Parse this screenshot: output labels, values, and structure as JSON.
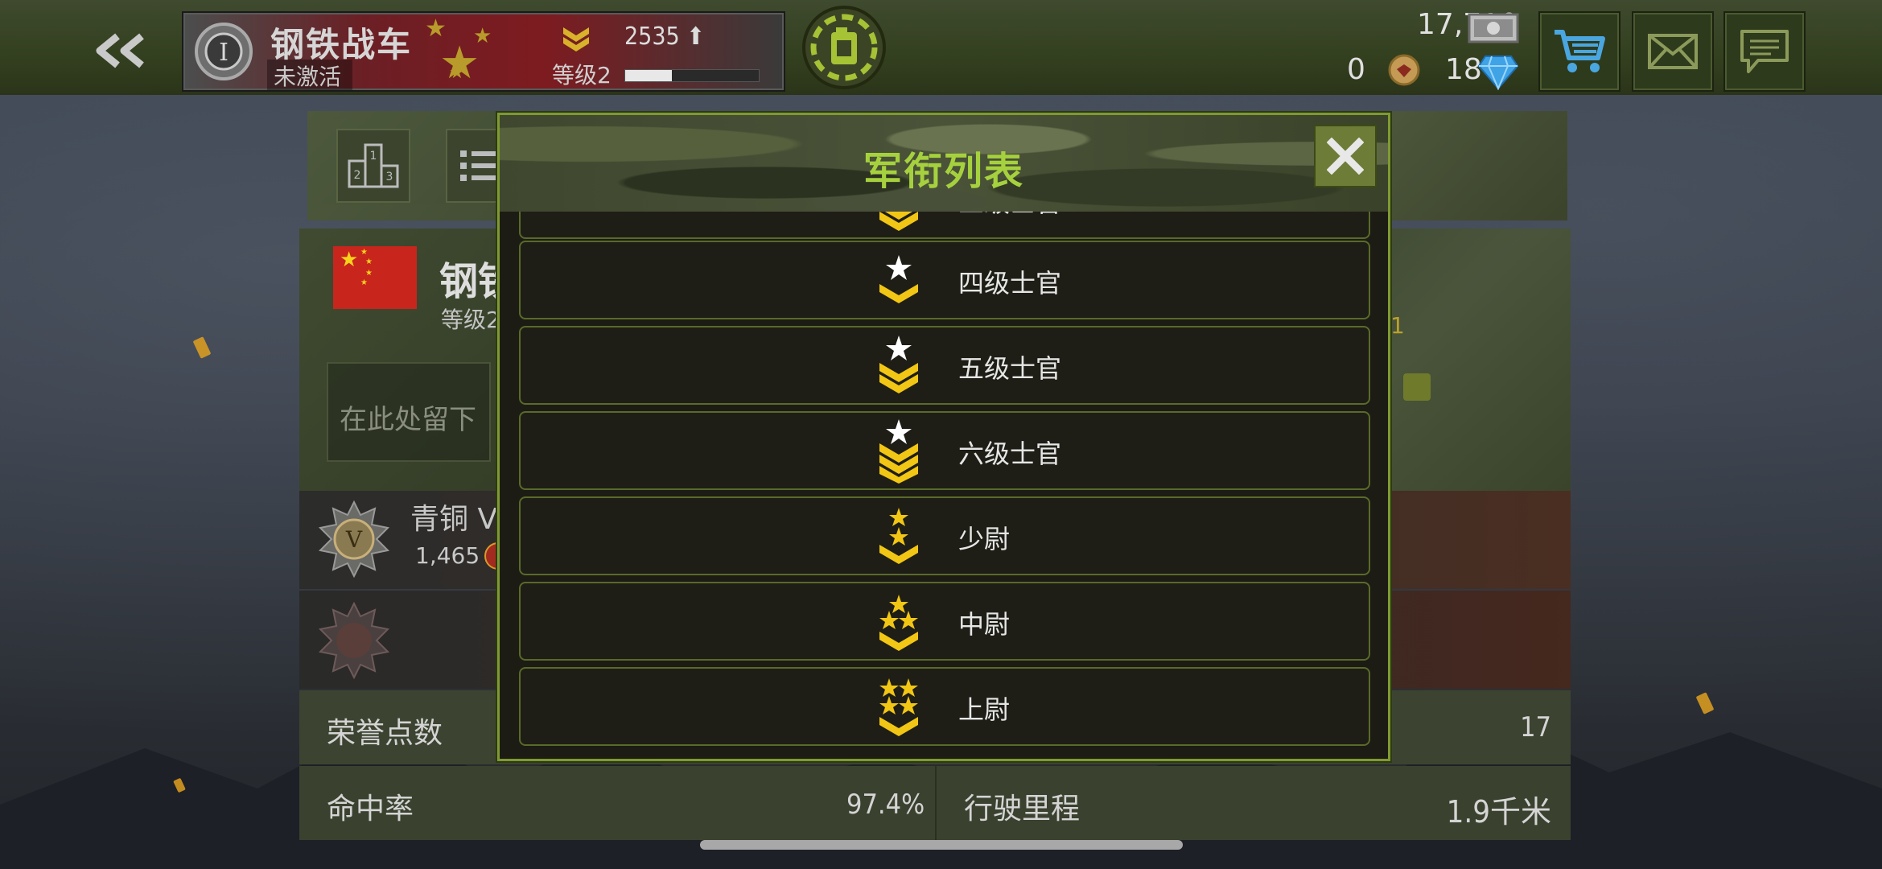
{
  "topbar": {
    "tank_name": "钢铁战车",
    "tank_status": "未激活",
    "xp": "2535",
    "level_label": "等级2",
    "level_progress": 0.35,
    "silver": "17,710",
    "gold": "0",
    "gems": "18"
  },
  "panel": {
    "player_name": "钢铁",
    "player_level": "等级2",
    "right_number": "1",
    "message_placeholder": "在此处留下",
    "rank_title": "青铜 V",
    "rank_score": "1,465",
    "stats": {
      "honor_label": "荣誉点数",
      "honor_value": "17",
      "accuracy_label": "命中率",
      "accuracy_value": "97.4%",
      "distance_label": "行驶里程",
      "distance_value": "1.9千米"
    }
  },
  "modal": {
    "title": "军衔列表",
    "items": [
      {
        "label": "三级士官",
        "icon": "chevron-2-icon"
      },
      {
        "label": "四级士官",
        "icon": "star-chevron-1-icon"
      },
      {
        "label": "五级士官",
        "icon": "star-chevron-2-icon"
      },
      {
        "label": "六级士官",
        "icon": "star-chevron-3-icon"
      },
      {
        "label": "少尉",
        "icon": "two-star-chevron-icon"
      },
      {
        "label": "中尉",
        "icon": "three-star-chevron-icon"
      },
      {
        "label": "上尉",
        "icon": "four-star-chevron-icon"
      }
    ]
  },
  "colors": {
    "accent_green": "#a6d13e",
    "modal_border": "#7f9a32",
    "item_border": "#596a2a",
    "rank_gold": "#f2c614"
  }
}
